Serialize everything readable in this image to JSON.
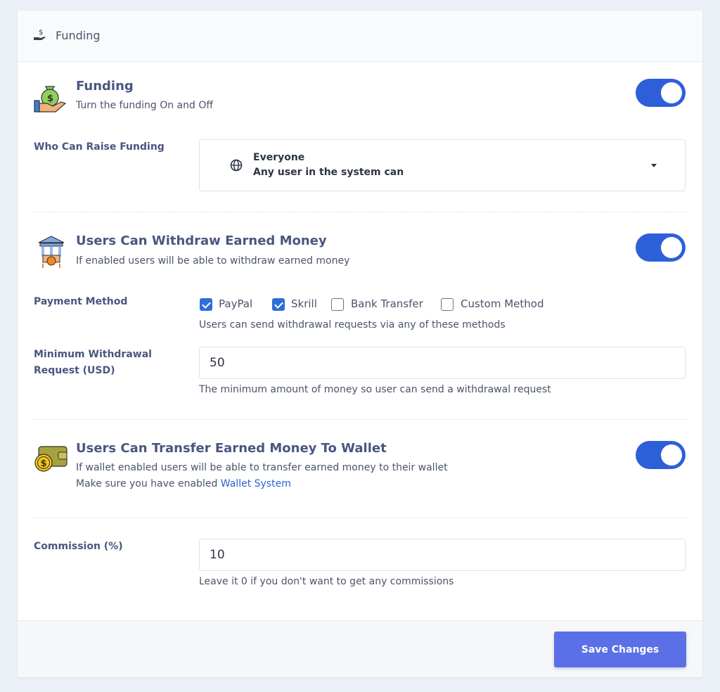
{
  "header": {
    "title": "Funding",
    "icon": "hand-coin-icon"
  },
  "funding": {
    "title": "Funding",
    "description": "Turn the funding On and Off",
    "enabled": true,
    "icon": "money-bag-hand-icon"
  },
  "who_can_raise": {
    "label": "Who Can Raise Funding",
    "selected_title": "Everyone",
    "selected_subtitle": "Any user in the system can",
    "icon": "globe-icon"
  },
  "withdraw": {
    "title": "Users Can Withdraw Earned Money",
    "description": "If enabled users will be able to withdraw earned money",
    "enabled": true,
    "icon": "bank-withdraw-icon"
  },
  "payment_method": {
    "label": "Payment Method",
    "options": [
      {
        "label": "PayPal",
        "checked": true
      },
      {
        "label": "Skrill",
        "checked": true
      },
      {
        "label": "Bank Transfer",
        "checked": false
      },
      {
        "label": "Custom Method",
        "checked": false
      }
    ],
    "hint": "Users can send withdrawal requests via any of these methods"
  },
  "min_withdrawal": {
    "label": "Minimum Withdrawal Request (USD)",
    "value": "50",
    "hint": "The minimum amount of money so user can send a withdrawal request"
  },
  "transfer": {
    "title": "Users Can Transfer Earned Money To Wallet",
    "description": "If wallet enabled users will be able to transfer earned money to their wallet",
    "note_prefix": "Make sure you have enabled ",
    "note_link": "Wallet System",
    "enabled": true,
    "icon": "wallet-coin-icon"
  },
  "commission": {
    "label": "Commission (%)",
    "value": "10",
    "hint": "Leave it 0 if you don't want to get any commissions"
  },
  "footer": {
    "save_label": "Save Changes"
  },
  "colors": {
    "accent": "#2d60d8",
    "button": "#5b6fe6",
    "link": "#2b62d1"
  }
}
